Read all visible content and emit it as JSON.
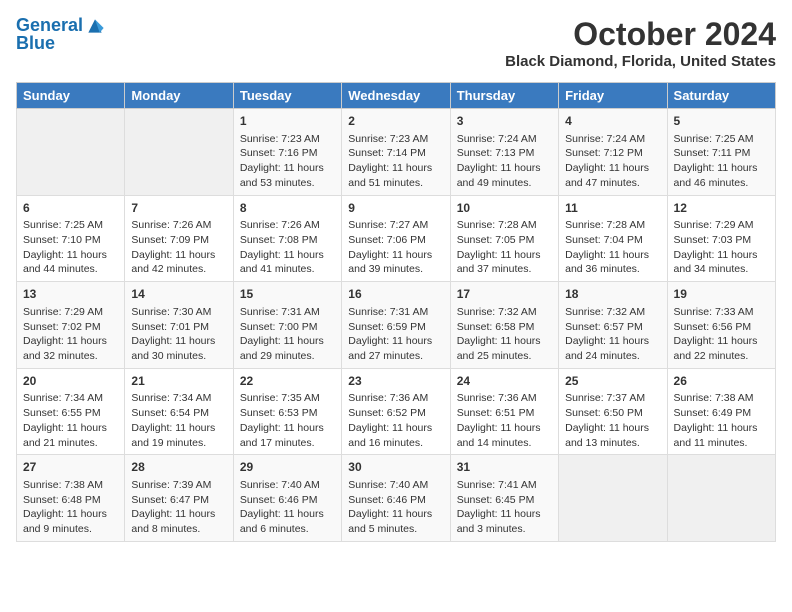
{
  "logo": {
    "line1": "General",
    "line2": "Blue"
  },
  "title": "October 2024",
  "subtitle": "Black Diamond, Florida, United States",
  "days_of_week": [
    "Sunday",
    "Monday",
    "Tuesday",
    "Wednesday",
    "Thursday",
    "Friday",
    "Saturday"
  ],
  "weeks": [
    [
      {
        "day": "",
        "sunrise": "",
        "sunset": "",
        "daylight": "",
        "empty": true
      },
      {
        "day": "",
        "sunrise": "",
        "sunset": "",
        "daylight": "",
        "empty": true
      },
      {
        "day": "1",
        "sunrise": "Sunrise: 7:23 AM",
        "sunset": "Sunset: 7:16 PM",
        "daylight": "Daylight: 11 hours and 53 minutes."
      },
      {
        "day": "2",
        "sunrise": "Sunrise: 7:23 AM",
        "sunset": "Sunset: 7:14 PM",
        "daylight": "Daylight: 11 hours and 51 minutes."
      },
      {
        "day": "3",
        "sunrise": "Sunrise: 7:24 AM",
        "sunset": "Sunset: 7:13 PM",
        "daylight": "Daylight: 11 hours and 49 minutes."
      },
      {
        "day": "4",
        "sunrise": "Sunrise: 7:24 AM",
        "sunset": "Sunset: 7:12 PM",
        "daylight": "Daylight: 11 hours and 47 minutes."
      },
      {
        "day": "5",
        "sunrise": "Sunrise: 7:25 AM",
        "sunset": "Sunset: 7:11 PM",
        "daylight": "Daylight: 11 hours and 46 minutes."
      }
    ],
    [
      {
        "day": "6",
        "sunrise": "Sunrise: 7:25 AM",
        "sunset": "Sunset: 7:10 PM",
        "daylight": "Daylight: 11 hours and 44 minutes."
      },
      {
        "day": "7",
        "sunrise": "Sunrise: 7:26 AM",
        "sunset": "Sunset: 7:09 PM",
        "daylight": "Daylight: 11 hours and 42 minutes."
      },
      {
        "day": "8",
        "sunrise": "Sunrise: 7:26 AM",
        "sunset": "Sunset: 7:08 PM",
        "daylight": "Daylight: 11 hours and 41 minutes."
      },
      {
        "day": "9",
        "sunrise": "Sunrise: 7:27 AM",
        "sunset": "Sunset: 7:06 PM",
        "daylight": "Daylight: 11 hours and 39 minutes."
      },
      {
        "day": "10",
        "sunrise": "Sunrise: 7:28 AM",
        "sunset": "Sunset: 7:05 PM",
        "daylight": "Daylight: 11 hours and 37 minutes."
      },
      {
        "day": "11",
        "sunrise": "Sunrise: 7:28 AM",
        "sunset": "Sunset: 7:04 PM",
        "daylight": "Daylight: 11 hours and 36 minutes."
      },
      {
        "day": "12",
        "sunrise": "Sunrise: 7:29 AM",
        "sunset": "Sunset: 7:03 PM",
        "daylight": "Daylight: 11 hours and 34 minutes."
      }
    ],
    [
      {
        "day": "13",
        "sunrise": "Sunrise: 7:29 AM",
        "sunset": "Sunset: 7:02 PM",
        "daylight": "Daylight: 11 hours and 32 minutes."
      },
      {
        "day": "14",
        "sunrise": "Sunrise: 7:30 AM",
        "sunset": "Sunset: 7:01 PM",
        "daylight": "Daylight: 11 hours and 30 minutes."
      },
      {
        "day": "15",
        "sunrise": "Sunrise: 7:31 AM",
        "sunset": "Sunset: 7:00 PM",
        "daylight": "Daylight: 11 hours and 29 minutes."
      },
      {
        "day": "16",
        "sunrise": "Sunrise: 7:31 AM",
        "sunset": "Sunset: 6:59 PM",
        "daylight": "Daylight: 11 hours and 27 minutes."
      },
      {
        "day": "17",
        "sunrise": "Sunrise: 7:32 AM",
        "sunset": "Sunset: 6:58 PM",
        "daylight": "Daylight: 11 hours and 25 minutes."
      },
      {
        "day": "18",
        "sunrise": "Sunrise: 7:32 AM",
        "sunset": "Sunset: 6:57 PM",
        "daylight": "Daylight: 11 hours and 24 minutes."
      },
      {
        "day": "19",
        "sunrise": "Sunrise: 7:33 AM",
        "sunset": "Sunset: 6:56 PM",
        "daylight": "Daylight: 11 hours and 22 minutes."
      }
    ],
    [
      {
        "day": "20",
        "sunrise": "Sunrise: 7:34 AM",
        "sunset": "Sunset: 6:55 PM",
        "daylight": "Daylight: 11 hours and 21 minutes."
      },
      {
        "day": "21",
        "sunrise": "Sunrise: 7:34 AM",
        "sunset": "Sunset: 6:54 PM",
        "daylight": "Daylight: 11 hours and 19 minutes."
      },
      {
        "day": "22",
        "sunrise": "Sunrise: 7:35 AM",
        "sunset": "Sunset: 6:53 PM",
        "daylight": "Daylight: 11 hours and 17 minutes."
      },
      {
        "day": "23",
        "sunrise": "Sunrise: 7:36 AM",
        "sunset": "Sunset: 6:52 PM",
        "daylight": "Daylight: 11 hours and 16 minutes."
      },
      {
        "day": "24",
        "sunrise": "Sunrise: 7:36 AM",
        "sunset": "Sunset: 6:51 PM",
        "daylight": "Daylight: 11 hours and 14 minutes."
      },
      {
        "day": "25",
        "sunrise": "Sunrise: 7:37 AM",
        "sunset": "Sunset: 6:50 PM",
        "daylight": "Daylight: 11 hours and 13 minutes."
      },
      {
        "day": "26",
        "sunrise": "Sunrise: 7:38 AM",
        "sunset": "Sunset: 6:49 PM",
        "daylight": "Daylight: 11 hours and 11 minutes."
      }
    ],
    [
      {
        "day": "27",
        "sunrise": "Sunrise: 7:38 AM",
        "sunset": "Sunset: 6:48 PM",
        "daylight": "Daylight: 11 hours and 9 minutes."
      },
      {
        "day": "28",
        "sunrise": "Sunrise: 7:39 AM",
        "sunset": "Sunset: 6:47 PM",
        "daylight": "Daylight: 11 hours and 8 minutes."
      },
      {
        "day": "29",
        "sunrise": "Sunrise: 7:40 AM",
        "sunset": "Sunset: 6:46 PM",
        "daylight": "Daylight: 11 hours and 6 minutes."
      },
      {
        "day": "30",
        "sunrise": "Sunrise: 7:40 AM",
        "sunset": "Sunset: 6:46 PM",
        "daylight": "Daylight: 11 hours and 5 minutes."
      },
      {
        "day": "31",
        "sunrise": "Sunrise: 7:41 AM",
        "sunset": "Sunset: 6:45 PM",
        "daylight": "Daylight: 11 hours and 3 minutes."
      },
      {
        "day": "",
        "sunrise": "",
        "sunset": "",
        "daylight": "",
        "empty": true
      },
      {
        "day": "",
        "sunrise": "",
        "sunset": "",
        "daylight": "",
        "empty": true
      }
    ]
  ]
}
